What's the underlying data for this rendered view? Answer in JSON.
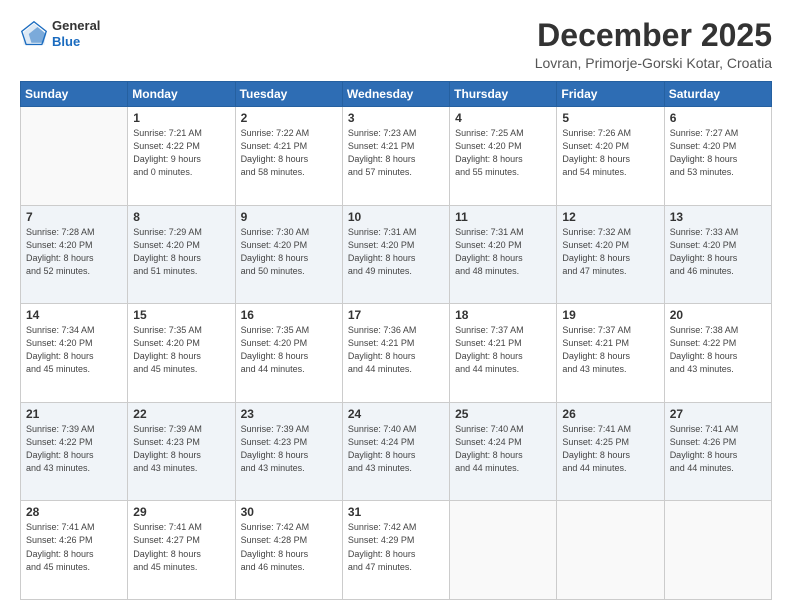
{
  "logo": {
    "general": "General",
    "blue": "Blue"
  },
  "title": "December 2025",
  "location": "Lovran, Primorje-Gorski Kotar, Croatia",
  "days_of_week": [
    "Sunday",
    "Monday",
    "Tuesday",
    "Wednesday",
    "Thursday",
    "Friday",
    "Saturday"
  ],
  "weeks": [
    [
      {
        "day": "",
        "info": ""
      },
      {
        "day": "1",
        "info": "Sunrise: 7:21 AM\nSunset: 4:22 PM\nDaylight: 9 hours\nand 0 minutes."
      },
      {
        "day": "2",
        "info": "Sunrise: 7:22 AM\nSunset: 4:21 PM\nDaylight: 8 hours\nand 58 minutes."
      },
      {
        "day": "3",
        "info": "Sunrise: 7:23 AM\nSunset: 4:21 PM\nDaylight: 8 hours\nand 57 minutes."
      },
      {
        "day": "4",
        "info": "Sunrise: 7:25 AM\nSunset: 4:20 PM\nDaylight: 8 hours\nand 55 minutes."
      },
      {
        "day": "5",
        "info": "Sunrise: 7:26 AM\nSunset: 4:20 PM\nDaylight: 8 hours\nand 54 minutes."
      },
      {
        "day": "6",
        "info": "Sunrise: 7:27 AM\nSunset: 4:20 PM\nDaylight: 8 hours\nand 53 minutes."
      }
    ],
    [
      {
        "day": "7",
        "info": "Sunrise: 7:28 AM\nSunset: 4:20 PM\nDaylight: 8 hours\nand 52 minutes."
      },
      {
        "day": "8",
        "info": "Sunrise: 7:29 AM\nSunset: 4:20 PM\nDaylight: 8 hours\nand 51 minutes."
      },
      {
        "day": "9",
        "info": "Sunrise: 7:30 AM\nSunset: 4:20 PM\nDaylight: 8 hours\nand 50 minutes."
      },
      {
        "day": "10",
        "info": "Sunrise: 7:31 AM\nSunset: 4:20 PM\nDaylight: 8 hours\nand 49 minutes."
      },
      {
        "day": "11",
        "info": "Sunrise: 7:31 AM\nSunset: 4:20 PM\nDaylight: 8 hours\nand 48 minutes."
      },
      {
        "day": "12",
        "info": "Sunrise: 7:32 AM\nSunset: 4:20 PM\nDaylight: 8 hours\nand 47 minutes."
      },
      {
        "day": "13",
        "info": "Sunrise: 7:33 AM\nSunset: 4:20 PM\nDaylight: 8 hours\nand 46 minutes."
      }
    ],
    [
      {
        "day": "14",
        "info": "Sunrise: 7:34 AM\nSunset: 4:20 PM\nDaylight: 8 hours\nand 45 minutes."
      },
      {
        "day": "15",
        "info": "Sunrise: 7:35 AM\nSunset: 4:20 PM\nDaylight: 8 hours\nand 45 minutes."
      },
      {
        "day": "16",
        "info": "Sunrise: 7:35 AM\nSunset: 4:20 PM\nDaylight: 8 hours\nand 44 minutes."
      },
      {
        "day": "17",
        "info": "Sunrise: 7:36 AM\nSunset: 4:21 PM\nDaylight: 8 hours\nand 44 minutes."
      },
      {
        "day": "18",
        "info": "Sunrise: 7:37 AM\nSunset: 4:21 PM\nDaylight: 8 hours\nand 44 minutes."
      },
      {
        "day": "19",
        "info": "Sunrise: 7:37 AM\nSunset: 4:21 PM\nDaylight: 8 hours\nand 43 minutes."
      },
      {
        "day": "20",
        "info": "Sunrise: 7:38 AM\nSunset: 4:22 PM\nDaylight: 8 hours\nand 43 minutes."
      }
    ],
    [
      {
        "day": "21",
        "info": "Sunrise: 7:39 AM\nSunset: 4:22 PM\nDaylight: 8 hours\nand 43 minutes."
      },
      {
        "day": "22",
        "info": "Sunrise: 7:39 AM\nSunset: 4:23 PM\nDaylight: 8 hours\nand 43 minutes."
      },
      {
        "day": "23",
        "info": "Sunrise: 7:39 AM\nSunset: 4:23 PM\nDaylight: 8 hours\nand 43 minutes."
      },
      {
        "day": "24",
        "info": "Sunrise: 7:40 AM\nSunset: 4:24 PM\nDaylight: 8 hours\nand 43 minutes."
      },
      {
        "day": "25",
        "info": "Sunrise: 7:40 AM\nSunset: 4:24 PM\nDaylight: 8 hours\nand 44 minutes."
      },
      {
        "day": "26",
        "info": "Sunrise: 7:41 AM\nSunset: 4:25 PM\nDaylight: 8 hours\nand 44 minutes."
      },
      {
        "day": "27",
        "info": "Sunrise: 7:41 AM\nSunset: 4:26 PM\nDaylight: 8 hours\nand 44 minutes."
      }
    ],
    [
      {
        "day": "28",
        "info": "Sunrise: 7:41 AM\nSunset: 4:26 PM\nDaylight: 8 hours\nand 45 minutes."
      },
      {
        "day": "29",
        "info": "Sunrise: 7:41 AM\nSunset: 4:27 PM\nDaylight: 8 hours\nand 45 minutes."
      },
      {
        "day": "30",
        "info": "Sunrise: 7:42 AM\nSunset: 4:28 PM\nDaylight: 8 hours\nand 46 minutes."
      },
      {
        "day": "31",
        "info": "Sunrise: 7:42 AM\nSunset: 4:29 PM\nDaylight: 8 hours\nand 47 minutes."
      },
      {
        "day": "",
        "info": ""
      },
      {
        "day": "",
        "info": ""
      },
      {
        "day": "",
        "info": ""
      }
    ]
  ]
}
